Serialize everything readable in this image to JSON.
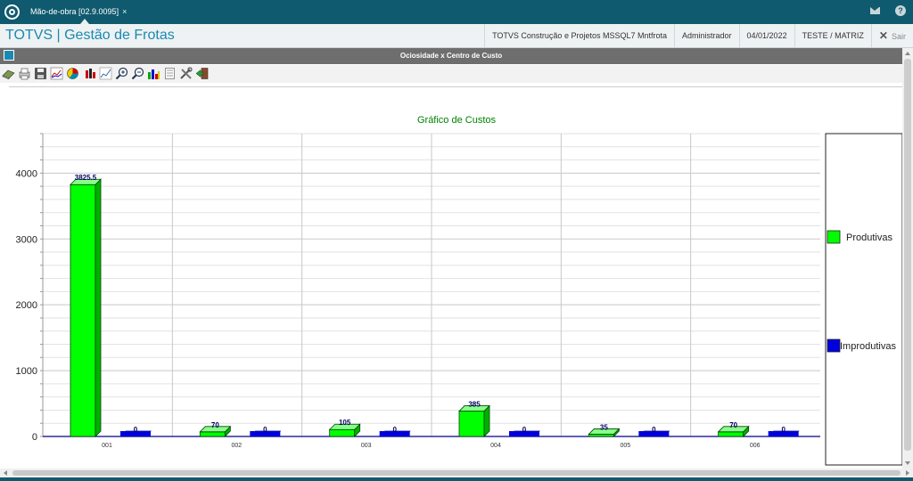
{
  "topbar": {
    "tab_label": "Mão-de-obra [02.9.0095]",
    "tab_close": "×",
    "mail_icon": "mail-icon",
    "help_icon": "help-icon",
    "help_glyph": "?"
  },
  "appbar": {
    "title": "TOTVS | Gestão de Frotas",
    "company": "TOTVS Construção e Projetos MSSQL7 Mntfrota",
    "user": "Administrador",
    "date": "04/01/2022",
    "branch": "TESTE / MATRIZ",
    "exit_label": "Sair"
  },
  "dialog": {
    "title": "Ociosidade x Centro de Custo"
  },
  "toolbar": {
    "icons": [
      "book-icon",
      "print-icon",
      "save-icon",
      "chart-type-icon",
      "pie-chart-icon",
      "bar-chart-icon",
      "line-chart-icon",
      "zoom-in-icon",
      "zoom-out-icon",
      "series-icon",
      "document-icon",
      "tools-icon",
      "exit-icon"
    ]
  },
  "colors": {
    "produtivas": "#00ff00",
    "improdutivas": "#0000dd",
    "title": "#008000",
    "accent": "#1a8ab0",
    "topbar": "#0f5a6e"
  },
  "chart_data": {
    "type": "bar",
    "title": "Gráfico de Custos",
    "categories": [
      "001",
      "002",
      "003",
      "004",
      "005",
      "006"
    ],
    "series": [
      {
        "name": "Produtivas",
        "values": [
          3825.5,
          70,
          105,
          385,
          35,
          70
        ],
        "labels": [
          "3825.5",
          "70",
          "105",
          "385",
          "35",
          "70"
        ]
      },
      {
        "name": "Improdutivas",
        "values": [
          0,
          0,
          0,
          0,
          0,
          0
        ],
        "labels": [
          "0",
          "0",
          "0",
          "0",
          "0",
          "0"
        ]
      }
    ],
    "yticks": [
      "0",
      "1000",
      "2000",
      "3000",
      "4000"
    ],
    "ylim": [
      0,
      4600
    ],
    "grid": true,
    "legend_position": "right"
  }
}
